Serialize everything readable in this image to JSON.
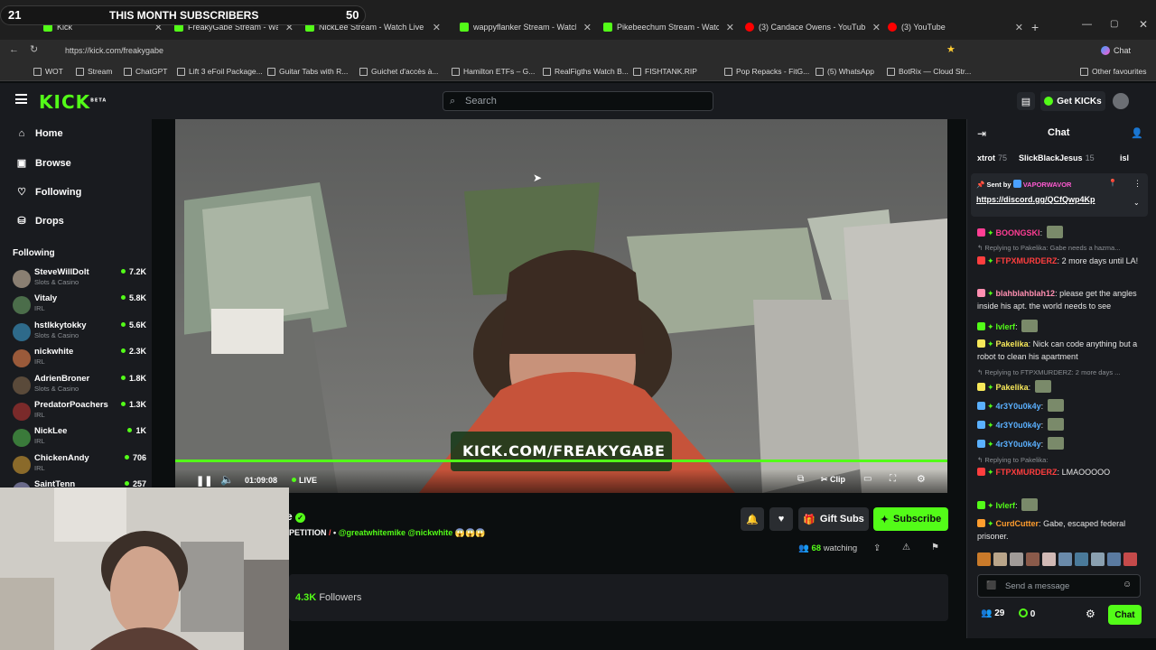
{
  "overlay": {
    "left_count": "21",
    "title": "THIS MONTH SUBSCRIBERS",
    "right_count": "50"
  },
  "tabs": [
    {
      "title": "Kick",
      "type": "kick"
    },
    {
      "title": "FreakyGabe Stream - Watch",
      "type": "kick"
    },
    {
      "title": "NickLee Stream - Watch Live",
      "type": "kick"
    },
    {
      "title": "wappyflanker Stream - Watch",
      "type": "kick"
    },
    {
      "title": "Pikebeechum Stream - Watch",
      "type": "kick"
    },
    {
      "title": "(3) Candace Owens - YouTube",
      "type": "yt"
    },
    {
      "title": "(3) YouTube",
      "type": "yt"
    }
  ],
  "browser": {
    "url": "https://kick.com/freakygabe",
    "copilot": "Chat"
  },
  "favorites": [
    "WOT",
    "Stream",
    "ChatGPT",
    "Lift 3 eFoil Package...",
    "Guitar Tabs with R...",
    "Guichet d'accès à...",
    "Hamilton ETFs – G...",
    "RealFigths Watch B...",
    "FISHTANK.RIP",
    "Pop Repacks - FitG...",
    "(5) WhatsApp",
    "BotRix — Cloud Str...",
    "Other favourites"
  ],
  "kick": {
    "logo": "KICK",
    "logo_beta": "BETA",
    "search_placeholder": "Search",
    "get_kicks": "Get KICKs",
    "nav": [
      {
        "label": "Home",
        "icon": "home-icon"
      },
      {
        "label": "Browse",
        "icon": "browse-icon"
      },
      {
        "label": "Following",
        "icon": "heart-icon"
      },
      {
        "label": "Drops",
        "icon": "drops-icon"
      }
    ],
    "following_title": "Following",
    "following": [
      {
        "name": "SteveWillDolt",
        "category": "Slots & Casino",
        "viewers": "7.2K",
        "color": "#8a7f72"
      },
      {
        "name": "Vitaly",
        "category": "IRL",
        "viewers": "5.8K",
        "color": "#4b6d4a"
      },
      {
        "name": "hstlkkytokky",
        "category": "Slots & Casino",
        "viewers": "5.6K",
        "color": "#2e6a8a"
      },
      {
        "name": "nickwhite",
        "category": "IRL",
        "viewers": "2.3K",
        "color": "#9a5a3a"
      },
      {
        "name": "AdrienBroner",
        "category": "Slots & Casino",
        "viewers": "1.8K",
        "color": "#5a4a3a"
      },
      {
        "name": "PredatorPoachers",
        "category": "IRL",
        "viewers": "1.3K",
        "color": "#7a2a2a"
      },
      {
        "name": "NickLee",
        "category": "IRL",
        "viewers": "1K",
        "color": "#3a7a3a"
      },
      {
        "name": "ChickenAndy",
        "category": "IRL",
        "viewers": "706",
        "color": "#8a6a2a"
      },
      {
        "name": "SaintTenn",
        "category": "",
        "viewers": "257",
        "color": "#6a6a8a"
      }
    ]
  },
  "player": {
    "watermark": "KICK.COM/FREAKYGABE",
    "time": "01:09:08",
    "live": "LIVE",
    "clip": "Clip",
    "progress_fraction": 1.0
  },
  "stream_info": {
    "title_fragment": "PETITION",
    "mentions": "@greatwhitemike @nickwhite",
    "gift_subs": "Gift Subs",
    "subscribe": "Subscribe",
    "watching_count": "68",
    "watching_label": "watching",
    "followers_count": "4.3K",
    "followers_label": "Followers",
    "name_tail": "e"
  },
  "chat": {
    "title": "Chat",
    "top_gifters": [
      {
        "name": "xtrot",
        "count": "75"
      },
      {
        "name": "SlickBlackJesus",
        "count": "15"
      },
      {
        "name": "isl",
        "count": ""
      }
    ],
    "pinned": {
      "sent_by": "Sent by",
      "user": "VAPORWAVOR",
      "link": "https://discord.gg/QCfQwp4Kp"
    },
    "messages": [
      {
        "kind": "msg",
        "user": "BOONGSKI",
        "color": "#ff3e94",
        "text": ""
      },
      {
        "kind": "reply",
        "text": "Replying to Pakelika: Gabe needs a hazma..."
      },
      {
        "kind": "msg",
        "user": "FTPXMURDERZ",
        "color": "#ff3e3e",
        "text": "2 more days until LA!"
      },
      {
        "kind": "msg",
        "user": "blahblahblah12",
        "color": "#ff8fb1",
        "text": "please get the angles inside his apt. the world needs to see"
      },
      {
        "kind": "msg",
        "user": "Ivlerf",
        "color": "#53fc18",
        "text": ""
      },
      {
        "kind": "msg",
        "user": "Pakelika",
        "color": "#f7e85a",
        "text": "Nick can code anything but a robot to clean his apartment"
      },
      {
        "kind": "reply",
        "text": "Replying to FTPXMURDERZ: 2 more days ..."
      },
      {
        "kind": "msg",
        "user": "Pakelika",
        "color": "#f7e85a",
        "text": ""
      },
      {
        "kind": "msg",
        "user": "4r3Y0u0k4y",
        "color": "#5ab0ff",
        "text": ""
      },
      {
        "kind": "msg",
        "user": "4r3Y0u0k4y",
        "color": "#5ab0ff",
        "text": ""
      },
      {
        "kind": "msg",
        "user": "4r3Y0u0k4y",
        "color": "#5ab0ff",
        "text": ""
      },
      {
        "kind": "reply",
        "text": "Replying to Pakelika:"
      },
      {
        "kind": "msg",
        "user": "FTPXMURDERZ",
        "color": "#ff3e3e",
        "text": "LMAOOOOO"
      },
      {
        "kind": "msg",
        "user": "Ivlerf",
        "color": "#53fc18",
        "text": ""
      },
      {
        "kind": "msg",
        "user": "CurdCutter",
        "color": "#ff9d2e",
        "text": "Gabe, escaped federal prisoner."
      }
    ],
    "input_placeholder": "Send a message",
    "stats": [
      {
        "icon": "users-icon",
        "value": "29"
      },
      {
        "icon": "kick-coin-icon",
        "value": "0"
      }
    ],
    "send_label": "Chat"
  }
}
